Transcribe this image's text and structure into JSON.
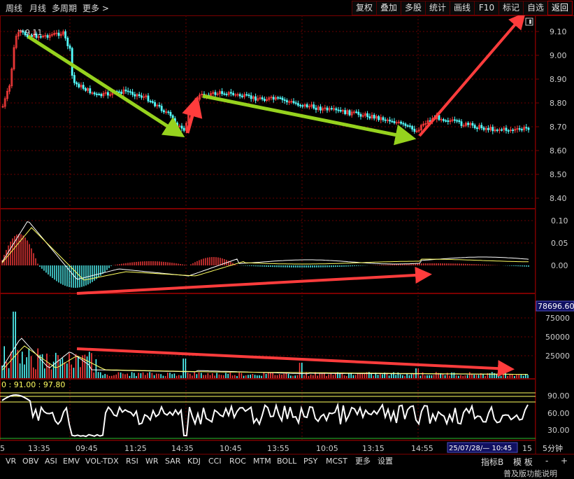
{
  "toolbar": {
    "left_items": [
      "周线",
      "月线",
      "多周期",
      "更多 >"
    ],
    "right_items": [
      "复权",
      "叠加",
      "多股",
      "统计",
      "画线",
      "F10",
      "标记",
      "自选",
      "返回"
    ],
    "active_right": "返回"
  },
  "price_panel": {
    "axis_ticks": [
      "9.10",
      "9.00",
      "8.90",
      "8.80",
      "8.70",
      "8.60",
      "8.50",
      "8.40"
    ],
    "high_label": "9.11"
  },
  "macd_panel": {
    "axis_ticks": [
      "0.10",
      "0.05",
      "0.00"
    ]
  },
  "volume_panel": {
    "current_value": "78696.60",
    "axis_ticks": [
      "75000",
      "50000",
      "25000"
    ]
  },
  "vr_panel": {
    "header_text": "0 : 91.00 : 97.80",
    "axis_ticks": [
      "90.00",
      "60.00",
      "30.00"
    ]
  },
  "time_axis": {
    "labels": [
      "5",
      "13:35",
      "09:45",
      "11:25",
      "14:35",
      "10:45",
      "13:55",
      "10:05",
      "13:15",
      "14:55",
      "15"
    ],
    "cursor_label": "25/07/28/— 10:45",
    "period": "5分钟"
  },
  "indicator_tabs": [
    "VR",
    "OBV",
    "ASI",
    "EMV",
    "VOL-TDX",
    "RSI",
    "WR",
    "SAR",
    "KDJ",
    "CCI",
    "ROC",
    "MTM",
    "BOLL",
    "PSY",
    "MCST",
    "更多",
    "设置"
  ],
  "bottom_right": {
    "indicator_b": "指标B",
    "template": "模 板",
    "minus": "-",
    "plus": "+"
  },
  "footer_note": "普及版功能说明",
  "colors": {
    "up": "#ff3c3c",
    "down": "#54ffff",
    "arrow_green": "#96d21e",
    "arrow_red": "#ff3c3c",
    "grid": "#7a0000",
    "yellow": "#ffff60",
    "white": "#ffffff"
  }
}
